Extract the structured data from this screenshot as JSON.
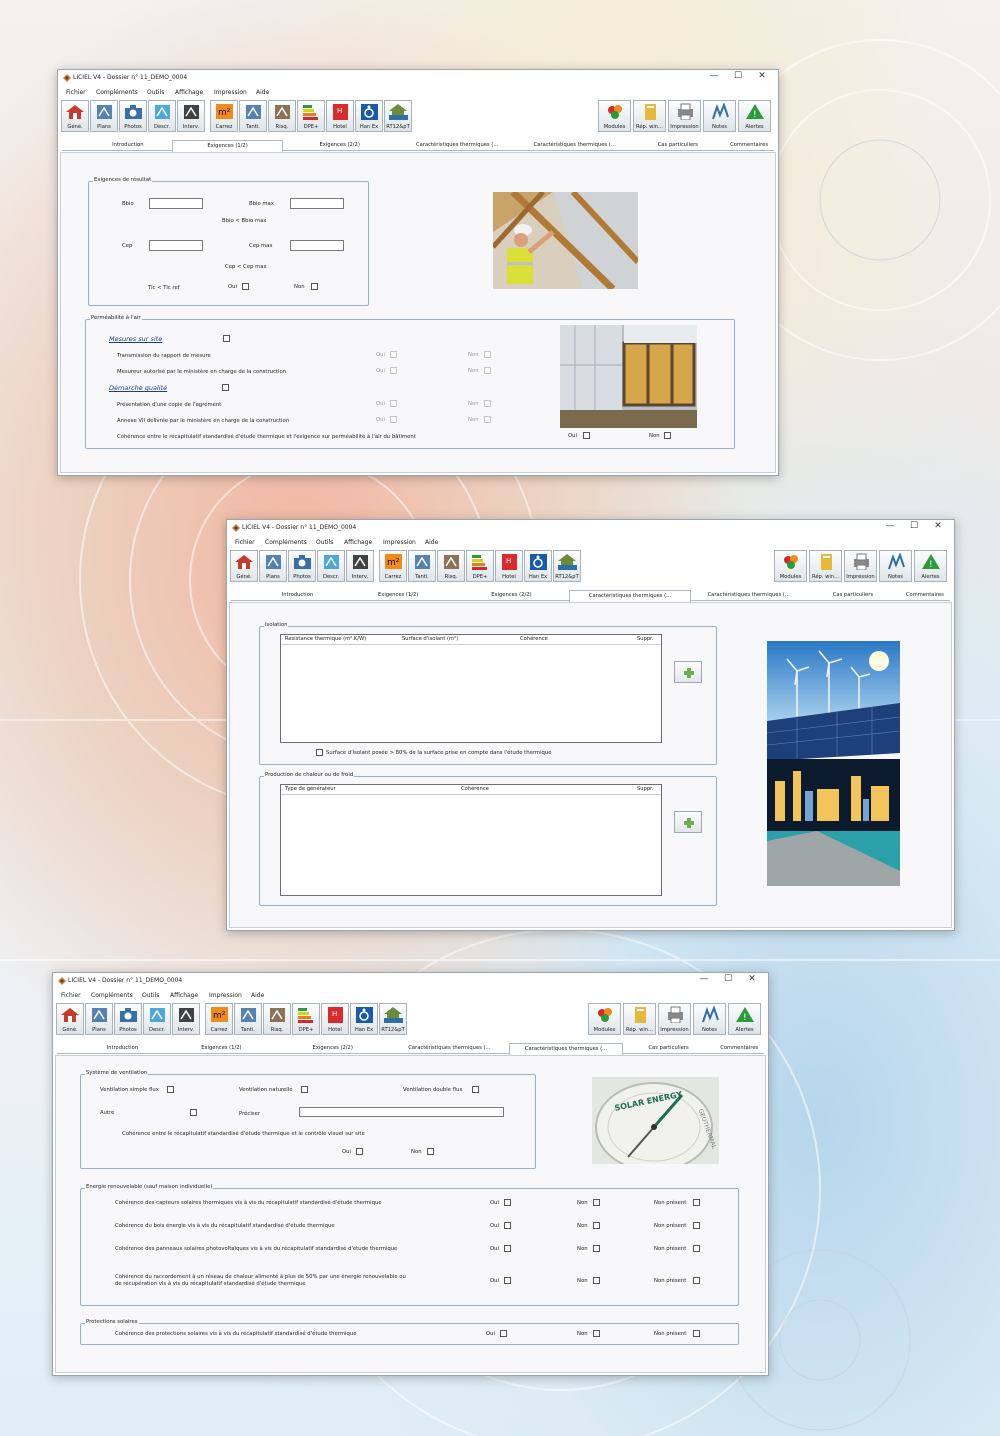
{
  "app_title": "LICIEL V4 - Dossier n° 11_DEMO_0004",
  "window_controls": {
    "minimize": "—",
    "maximize": "☐",
    "close": "✕"
  },
  "menu": [
    "Fichier",
    "Compléments",
    "Outils",
    "Affichage",
    "Impression",
    "Aide"
  ],
  "toolbar_left": [
    {
      "label": "Géné.",
      "icon": "house-icon"
    },
    {
      "label": "Plans",
      "icon": "plans-icon"
    },
    {
      "label": "Photos",
      "icon": "camera-icon"
    },
    {
      "label": "Descr.",
      "icon": "description-icon"
    },
    {
      "label": "Interv.",
      "icon": "intervention-icon"
    },
    {
      "label": "Carrez",
      "icon": "carrez-m2-icon"
    },
    {
      "label": "Tanti.",
      "icon": "tantiemes-icon"
    },
    {
      "label": "Risq.",
      "icon": "risk-icon"
    },
    {
      "label": "DPE+",
      "icon": "dpe-icon"
    },
    {
      "label": "Hotel",
      "icon": "hotel-icon"
    },
    {
      "label": "Han Ex",
      "icon": "handicap-icon"
    },
    {
      "label": "RT12&pT",
      "icon": "rt2012-house-icon"
    }
  ],
  "toolbar_right": [
    {
      "label": "Modules",
      "icon": "modules-icon"
    },
    {
      "label": "Rép. win...",
      "icon": "repertoire-icon"
    },
    {
      "label": "Impression",
      "icon": "printer-icon"
    },
    {
      "label": "Notes",
      "icon": "notes-icon"
    },
    {
      "label": "Alertes",
      "icon": "alert-icon"
    }
  ],
  "tabs": [
    "Introduction",
    "Exigences (1/2)",
    "Exigences (2/2)",
    "Caractéristiques thermiques (...",
    "Caractéristiques thermiques (...",
    "Cas particuliers",
    "Commentaires"
  ],
  "window1": {
    "active_tab": 1,
    "exigences_group": {
      "title": "Exigences de résultat",
      "bbio": "Bbio",
      "bbio_max": "Bbio max",
      "bbio_rule": "Bbio < Bbio max",
      "cep": "Cep",
      "cep_max": "Cep max",
      "cep_rule": "Cep < Cep max",
      "tic_rule": "Tic < Tic ref",
      "oui": "Oui",
      "non": "Non"
    },
    "permeabilite_group": {
      "title": "Perméabilité à l'air",
      "mesures": "Mesures sur site",
      "rows1": [
        "Transmission du rapport de mesure",
        "Mesureur autorisé par le ministère en charge de la construction"
      ],
      "demarche": "Démarche qualité",
      "rows2": [
        "Présentation d'une copie de l'agrément",
        "Annexe VII délivrée par le ministère en charge de la construction"
      ],
      "coherence": "Cohérence entre le récapitulatif standardisé d'étude thermique et l'exigence sur perméabilité à l'air du bâtiment",
      "oui": "Oui",
      "non": "Non"
    }
  },
  "window2": {
    "active_tab": 3,
    "isolation_group": {
      "title": "Isolation",
      "columns": [
        "Resistance thermique (m².K/W)",
        "Surface d'isolant (m²)",
        "Cohérence",
        "Suppr."
      ],
      "checkbox": "Surface d'isolant posée > 80% de la surface prise en compte dans l'étude thermique"
    },
    "production_group": {
      "title": "Production de chaleur ou de froid",
      "columns": [
        "Type de générateur",
        "Cohérence",
        "Suppr."
      ]
    },
    "add_symbol": "+"
  },
  "window3": {
    "active_tab": 4,
    "ventilation_group": {
      "title": "Système de ventilation",
      "simple": "Ventilation simple flux",
      "naturelle": "Ventilation naturelle",
      "double": "Ventilation double flux",
      "autre": "Autre",
      "preciser": "Préciser",
      "coherence": "Cohérence entre le récapitulatif standardisé d'étude thermique et le contrôle visuel sur site",
      "oui": "Oui",
      "non": "Non"
    },
    "energie_group": {
      "title": "Energie renouvelable (sauf maison individuelle)",
      "rows": [
        "Cohérence des capteurs solaires thermiques vis à vis du récapitulatif standardisé d'étude thermique",
        "Cohérence du bois énergie vis à vis du récapitulatif standardisé d'étude thermique",
        "Cohérence des panneaux solaires photovoltaïques vis à vis du récapitulatif standardisé d'étude thermique"
      ],
      "row4_line1": "Cohérence du raccordement à un réseau de chaleur alimenté à plus de 50% par une énergie renouvelable ou",
      "row4_line2": "de récupération vis à vis du récapitulatif standardisé d'étude thermique",
      "oui": "Oui",
      "non": "Non",
      "non_present": "Non présent"
    },
    "protections_group": {
      "title": "Protections solaires",
      "row": "Cohérence des protections solaires vis à vis du récapitulatif standardisé d'étude thermique",
      "oui": "Oui",
      "non": "Non",
      "non_present": "Non présent"
    },
    "compass_text1": "SOLAR ENERGY",
    "compass_text2": "GEOTHERMAL"
  },
  "colors": {
    "accent": "#2f6fa8",
    "tab_border": "#b0bac4",
    "group_border": "#9ab2c9"
  }
}
